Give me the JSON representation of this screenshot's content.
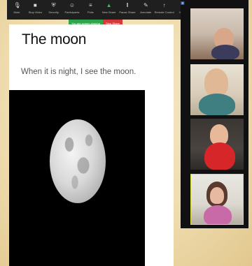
{
  "toolbar": {
    "items": [
      {
        "label": "Mute",
        "icon": "mic-icon"
      },
      {
        "label": "Stop Video",
        "icon": "video-icon"
      },
      {
        "label": "Security",
        "icon": "shield-icon"
      },
      {
        "label": "Participants",
        "icon": "participants-icon"
      },
      {
        "label": "Polls",
        "icon": "polls-icon"
      },
      {
        "label": "New Share",
        "icon": "share-icon"
      },
      {
        "label": "Pause Share",
        "icon": "pause-icon"
      },
      {
        "label": "Annotate",
        "icon": "annotate-icon"
      },
      {
        "label": "Remote Control",
        "icon": "remote-control-icon"
      },
      {
        "label": "More",
        "icon": "more-icon"
      }
    ],
    "active_index": 5
  },
  "share": {
    "status": "You are screen sharing",
    "stop": "Stop Share"
  },
  "slide": {
    "title": "The moon",
    "text": "When it is night, I see the moon."
  },
  "gallery": {
    "participants": [
      {
        "name": ""
      },
      {
        "name": ""
      },
      {
        "name": ""
      },
      {
        "name": ""
      }
    ]
  },
  "colors": {
    "toolbar_bg": "#1f1f1f",
    "share_green": "#2fa44a",
    "share_red": "#d53a3a",
    "active_speaker_border": "#d8e23a"
  }
}
